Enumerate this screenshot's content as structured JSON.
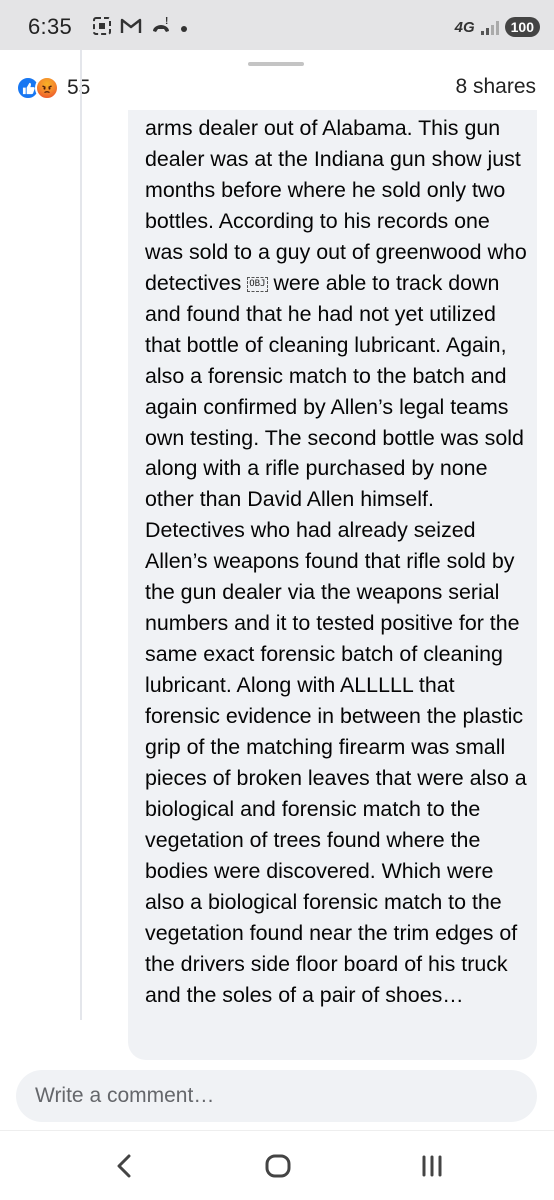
{
  "status_bar": {
    "time": "6:35",
    "network": "4G",
    "battery": "100",
    "icons": [
      "screenshot-icon",
      "gmail-icon",
      "missed-call-icon",
      "notification-dot-icon"
    ]
  },
  "post_stats": {
    "reactions": [
      "like",
      "angry"
    ],
    "reaction_count": "55",
    "shares": "8 shares"
  },
  "comment": {
    "text_before_obj": "arms dealer out of Alabama. This gun dealer was at the Indiana gun show just months before where he sold only two bottles. According to his records one was sold to a guy out of greenwood who detectives ",
    "obj_glyph": "OBJ",
    "text_after_obj": " were able to track down and found that he had not yet utilized that bottle of cleaning lubricant. Again, also a forensic match to the batch and again confirmed by Allen’s legal teams own testing. The second bottle was sold along with a rifle purchased by none other than David Allen himself. Detectives who had already seized Allen’s weapons found that rifle sold by the gun dealer via the weapons serial numbers and it to tested positive for the same exact forensic batch of cleaning lubricant. Along with ALLLLL that forensic evidence in between the plastic grip of the matching firearm was small pieces of broken leaves that were also a biological and forensic match to the vegetation of trees found where the bodies were discovered. Which were also a biological forensic match to the vegetation found near the trim edges of the drivers side floor board of his truck and the soles of a pair of shoes…"
  },
  "composer": {
    "placeholder": "Write a comment…"
  },
  "nav_bar": {
    "buttons": [
      "back-icon",
      "home-icon",
      "recents-icon"
    ]
  },
  "colors": {
    "facebook_blue": "#1877f2",
    "bubble_bg": "#f0f2f5",
    "status_bg": "#e4e4e6"
  }
}
